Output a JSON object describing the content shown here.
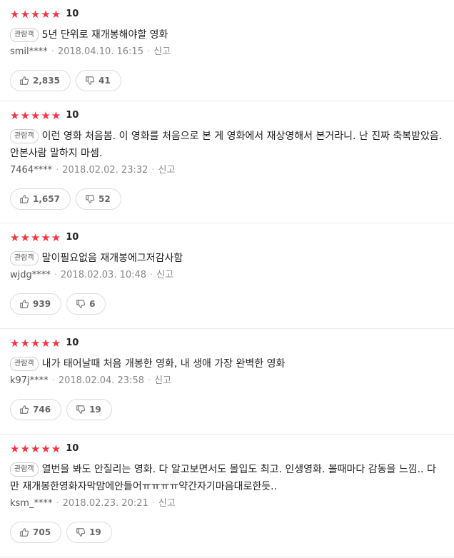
{
  "reviews": [
    {
      "stars": "★★★★★",
      "score": "10",
      "badge": "관람객",
      "text": "5년 단위로 재개봉해야할 영화",
      "author": "smil****",
      "date": "2018.04.10. 16:15",
      "report": "신고",
      "likes": "2,835",
      "dislikes": "41"
    },
    {
      "stars": "★★★★★",
      "score": "10",
      "badge": "관람객",
      "text": "이런 영화 처음봄. 이 영화를 처음으로 본 게 영화에서 재상영해서 본거라니. 난 진짜 축복받았음. 안본사람 말하지 마셈.",
      "author": "7464****",
      "date": "2018.02.02. 23:32",
      "report": "신고",
      "likes": "1,657",
      "dislikes": "52"
    },
    {
      "stars": "★★★★★",
      "score": "10",
      "badge": "관람객",
      "text": "말이필요없음 재개봉에그저감사함",
      "author": "wjdg****",
      "date": "2018.02.03. 10:48",
      "report": "신고",
      "likes": "939",
      "dislikes": "6"
    },
    {
      "stars": "★★★★★",
      "score": "10",
      "badge": "관람객",
      "text": "내가 태어날때 처음 개봉한 영화, 내 생애 가장 완벽한 영화",
      "author": "k97j****",
      "date": "2018.02.04. 23:58",
      "report": "신고",
      "likes": "746",
      "dislikes": "19"
    },
    {
      "stars": "★★★★★",
      "score": "10",
      "badge": "관람객",
      "text": "열번을 봐도 안질리는 영화. 다 알고보면서도 몰입도 최고. 인생영화. 볼때마다 감동을 느낌.. 다만 재개봉한영화자막맘에안들어ㅠㅠㅠㅠ약간자기마음대로한듯..",
      "author": "ksm_****",
      "date": "2018.02.23. 20:21",
      "report": "신고",
      "likes": "705",
      "dislikes": "19"
    }
  ]
}
